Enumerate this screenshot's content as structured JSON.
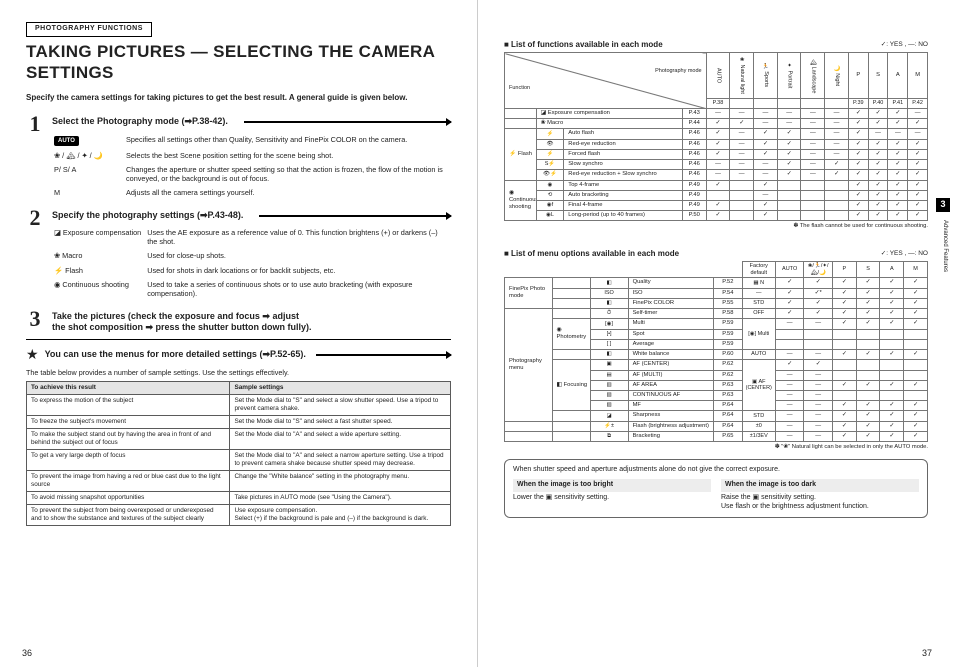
{
  "pageNumbers": {
    "left": "36",
    "right": "37"
  },
  "sideTab": {
    "num": "3",
    "label": "Advanced Features"
  },
  "left": {
    "sectionTag": "PHOTOGRAPHY FUNCTIONS",
    "title": "TAKING PICTURES — SELECTING THE CAMERA SETTINGS",
    "intro": "Specify the camera settings for taking pictures to get the best result. A general guide is given below.",
    "step1": {
      "head": "Select the Photography mode (➡P.38-42).",
      "rows": [
        {
          "lbl": "AUTO",
          "txt": "Specifies all settings other than Quality, Sensitivity and FinePix COLOR on the camera.",
          "badge": true
        },
        {
          "lbl": "❀ / 🏔 / ✦ / 🌙",
          "txt": "Selects the best Scene position setting for the scene being shot."
        },
        {
          "lbl": "P/ S/ A",
          "txt": "Changes the aperture or shutter speed setting so that the action is frozen, the flow of the motion is conveyed, or the background is out of focus."
        },
        {
          "lbl": "M",
          "txt": "Adjusts all the camera settings yourself."
        }
      ]
    },
    "step2": {
      "head": "Specify the photography settings (➡P.43-48).",
      "rows": [
        {
          "lbl": "◪  Exposure compensation",
          "txt": "Uses the AE exposure as a reference value of 0. This function brightens (+) or darkens (–) the shot."
        },
        {
          "lbl": "❀  Macro",
          "txt": "Used for close-up shots."
        },
        {
          "lbl": "⚡  Flash",
          "txt": "Used for shots in dark locations or for backlit subjects, etc."
        },
        {
          "lbl": "◉  Continuous shooting",
          "txt": "Used to take a series of continuous shots or to use auto bracketing (with exposure compensation)."
        }
      ]
    },
    "step3": {
      "l1": "Take the pictures (check the exposure and focus ➡ adjust",
      "l2": "the shot composition ➡ press the shutter button down fully)."
    },
    "star": "You can use the menus for more detailed settings (➡P.52-65).",
    "tableLead": "The table below provides a number of sample settings. Use the settings effectively.",
    "samples": {
      "h1": "To achieve this result",
      "h2": "Sample settings",
      "rows": [
        {
          "a": "To express the motion of the subject",
          "b": "Set the Mode dial to \"S\" and select a slow shutter speed. Use a tripod to prevent camera shake."
        },
        {
          "a": "To freeze the subject's movement",
          "b": "Set the Mode dial to \"S\" and select a fast shutter speed."
        },
        {
          "a": "To make the subject stand out by having the area in front of and behind the subject out of focus",
          "b": "Set the Mode dial to \"A\" and select a wide aperture setting."
        },
        {
          "a": "To get a very large depth of focus",
          "b": "Set the Mode dial to \"A\" and select a narrow aperture setting. Use a tripod to prevent camera shake because shutter speed may decrease."
        },
        {
          "a": "To prevent the image from having a red or blue cast due to the light source",
          "b": "Change the \"White balance\" setting in the photography menu."
        },
        {
          "a": "To avoid missing snapshot opportunities",
          "b": "Take pictures in AUTO mode (see \"Using the Camera\")."
        },
        {
          "a": "To prevent the subject from being overexposed or underexposed and to show the substance and textures of the subject clearly",
          "b": "Use exposure compensation.\nSelect (+) if the background is pale and (–) if the background is dark."
        }
      ]
    }
  },
  "right": {
    "legend": "✓: YES , —: NO",
    "t1": {
      "title": "■ List of functions available in each mode",
      "diagTop": "Photography mode",
      "diagBottom": "Function",
      "modeRef": [
        "P.38",
        "",
        "",
        "",
        "",
        "",
        "P.39",
        "P.40",
        "P.41",
        "P.42"
      ],
      "modeIcons": [
        "AUTO",
        "❀ Natural light",
        "🏃 Sports",
        "✦ Portrait",
        "🏔 Landscape",
        "🌙 Night",
        "P",
        "S",
        "A",
        "M"
      ],
      "rows": [
        {
          "g": "",
          "i": "",
          "n": "◪ Exposure compensation",
          "p": "P.43",
          "c": [
            "—",
            "—",
            "—",
            "—",
            "—",
            "—",
            "✓",
            "✓",
            "✓",
            "—"
          ]
        },
        {
          "g": "",
          "i": "",
          "n": "❀ Macro",
          "p": "P.44",
          "c": [
            "✓",
            "✓",
            "—",
            "—",
            "—",
            "—",
            "✓",
            "✓",
            "✓",
            "✓"
          ]
        },
        {
          "g": "⚡ Flash",
          "i": "⚡",
          "n": "Auto flash",
          "p": "P.46",
          "c": [
            "✓",
            "—",
            "✓",
            "✓",
            "—",
            "—",
            "✓",
            "—",
            "—",
            "—"
          ],
          "span": 5
        },
        {
          "g": "",
          "i": "👁",
          "n": "Red-eye reduction",
          "p": "P.46",
          "c": [
            "✓",
            "—",
            "✓",
            "✓",
            "—",
            "—",
            "✓",
            "✓",
            "✓",
            "✓"
          ]
        },
        {
          "g": "",
          "i": "⚡",
          "n": "Forced flash",
          "p": "P.46",
          "c": [
            "✓",
            "—",
            "✓",
            "✓",
            "—",
            "—",
            "✓",
            "✓",
            "✓",
            "✓"
          ]
        },
        {
          "g": "",
          "i": "S⚡",
          "n": "Slow synchro",
          "p": "P.46",
          "c": [
            "—",
            "—",
            "—",
            "✓",
            "—",
            "✓",
            "✓",
            "✓",
            "✓",
            "✓"
          ]
        },
        {
          "g": "",
          "i": "👁⚡",
          "n": "Red-eye reduction + Slow synchro",
          "p": "P.46",
          "c": [
            "—",
            "—",
            "—",
            "✓",
            "—",
            "✓",
            "✓",
            "✓",
            "✓",
            "✓"
          ]
        },
        {
          "g": "◉ Continuous shooting",
          "i": "◉",
          "n": "Top 4-frame",
          "p": "P.49",
          "c": [
            "✓",
            "",
            "✓",
            "",
            "",
            "",
            "✓",
            "✓",
            "✓",
            "✓"
          ],
          "span": 4
        },
        {
          "g": "",
          "i": "⟲",
          "n": "Auto bracketing",
          "p": "P.49",
          "c": [
            "",
            "",
            "—",
            "",
            "",
            "",
            "✓",
            "✓",
            "✓",
            "✓"
          ]
        },
        {
          "g": "",
          "i": "◉f",
          "n": "Final 4-frame",
          "p": "P.49",
          "c": [
            "✓",
            "",
            "✓",
            "",
            "",
            "",
            "✓",
            "✓",
            "✓",
            "✓"
          ]
        },
        {
          "g": "",
          "i": "◉L",
          "n": "Long-period (up to 40 frames)",
          "p": "P.50",
          "c": [
            "✓",
            "",
            "✓",
            "",
            "",
            "",
            "✓",
            "✓",
            "✓",
            "✓"
          ]
        }
      ],
      "foot": "✽ The flash cannot be used for continuous shooting."
    },
    "t2": {
      "title": "■ List of menu options available in each mode",
      "factory": "Factory default",
      "modeIcons": [
        "AUTO",
        "❀/🏃/✦/🏔/🌙",
        "P",
        "S",
        "A",
        "M"
      ],
      "rows": [
        {
          "g": "FinePix Photo mode",
          "i": "◧",
          "n": "Quality",
          "p": "P.52",
          "d": "▦ N",
          "c": [
            "✓",
            "✓",
            "✓",
            "✓",
            "✓",
            "✓"
          ],
          "span": 3
        },
        {
          "g": "",
          "i": "ISO",
          "n": "ISO",
          "p": "P.54",
          "d": "—",
          "c": [
            "✓",
            "✓*",
            "✓",
            "✓",
            "✓",
            "✓"
          ]
        },
        {
          "g": "",
          "i": "◧",
          "n": "FinePix COLOR",
          "p": "P.55",
          "d": "STD",
          "c": [
            "✓",
            "✓",
            "✓",
            "✓",
            "✓",
            "✓"
          ]
        },
        {
          "g": "Photography menu",
          "i": "⏱",
          "n": "Self-timer",
          "p": "P.58",
          "d": "OFF",
          "c": [
            "✓",
            "✓",
            "✓",
            "✓",
            "✓",
            "✓"
          ],
          "span": 11
        },
        {
          "g2": "◉ Photometry",
          "i": "[◉]",
          "n": "Multi",
          "p": "P.59",
          "d": "[◉] Multi",
          "c": [
            "—",
            "—",
            "✓",
            "✓",
            "✓",
            "✓"
          ],
          "span2": 3,
          "dspan": 3
        },
        {
          "i": "[•]",
          "n": "Spot",
          "p": "P.59",
          "c": [
            "",
            "",
            "",
            "",
            "",
            ""
          ]
        },
        {
          "i": "[ ]",
          "n": "Average",
          "p": "P.59",
          "c": [
            "",
            "",
            "",
            "",
            "",
            ""
          ]
        },
        {
          "g": "",
          "i": "◧",
          "n": "White balance",
          "p": "P.60",
          "d": "AUTO",
          "c": [
            "—",
            "—",
            "✓",
            "✓",
            "✓",
            "✓"
          ]
        },
        {
          "g2": "◧ Focusing",
          "i": "▣",
          "n": "AF (CENTER)",
          "p": "P.62",
          "d": "▣ AF (CENTER)",
          "c": [
            "✓",
            "✓",
            "",
            "",
            "",
            ""
          ],
          "span2": 5,
          "dspan": 5
        },
        {
          "i": "▤",
          "n": "AF (MULTI)",
          "p": "P.62",
          "c": [
            "—",
            "—",
            "",
            "",
            "",
            ""
          ]
        },
        {
          "i": "▥",
          "n": "AF AREA",
          "p": "P.63",
          "c": [
            "—",
            "—",
            "✓",
            "✓",
            "✓",
            "✓"
          ]
        },
        {
          "i": "▧",
          "n": "CONTINUOUS AF",
          "p": "P.63",
          "c": [
            "—",
            "—",
            "",
            "",
            "",
            ""
          ]
        },
        {
          "i": "▨",
          "n": "MF",
          "p": "P.64",
          "c": [
            "—",
            "—",
            "✓",
            "✓",
            "✓",
            "✓"
          ]
        },
        {
          "g": "",
          "i": "◪",
          "n": "Sharpness",
          "p": "P.64",
          "d": "STD",
          "c": [
            "—",
            "—",
            "✓",
            "✓",
            "✓",
            "✓"
          ]
        },
        {
          "g": "",
          "i": "⚡±",
          "n": "Flash (brightness adjustment)",
          "p": "P.64",
          "d": "±0",
          "c": [
            "—",
            "—",
            "✓",
            "✓",
            "✓",
            "✓"
          ]
        },
        {
          "g": "",
          "i": "⧉",
          "n": "Bracketing",
          "p": "P.65",
          "d": "±1/3EV",
          "c": [
            "—",
            "—",
            "✓",
            "✓",
            "✓",
            "✓"
          ]
        }
      ],
      "foot": "✽ \"❀\" Natural light can be selected in only the AUTO mode."
    },
    "expBox": {
      "head": "When shutter speed and aperture adjustments alone do not give the correct exposure.",
      "bright": {
        "t": "When the image is too bright",
        "b": "Lower the  ▣  sensitivity setting."
      },
      "dark": {
        "t": "When the image is too dark",
        "b": "Raise the  ▣  sensitivity setting.\nUse flash or the brightness adjustment function."
      }
    }
  }
}
